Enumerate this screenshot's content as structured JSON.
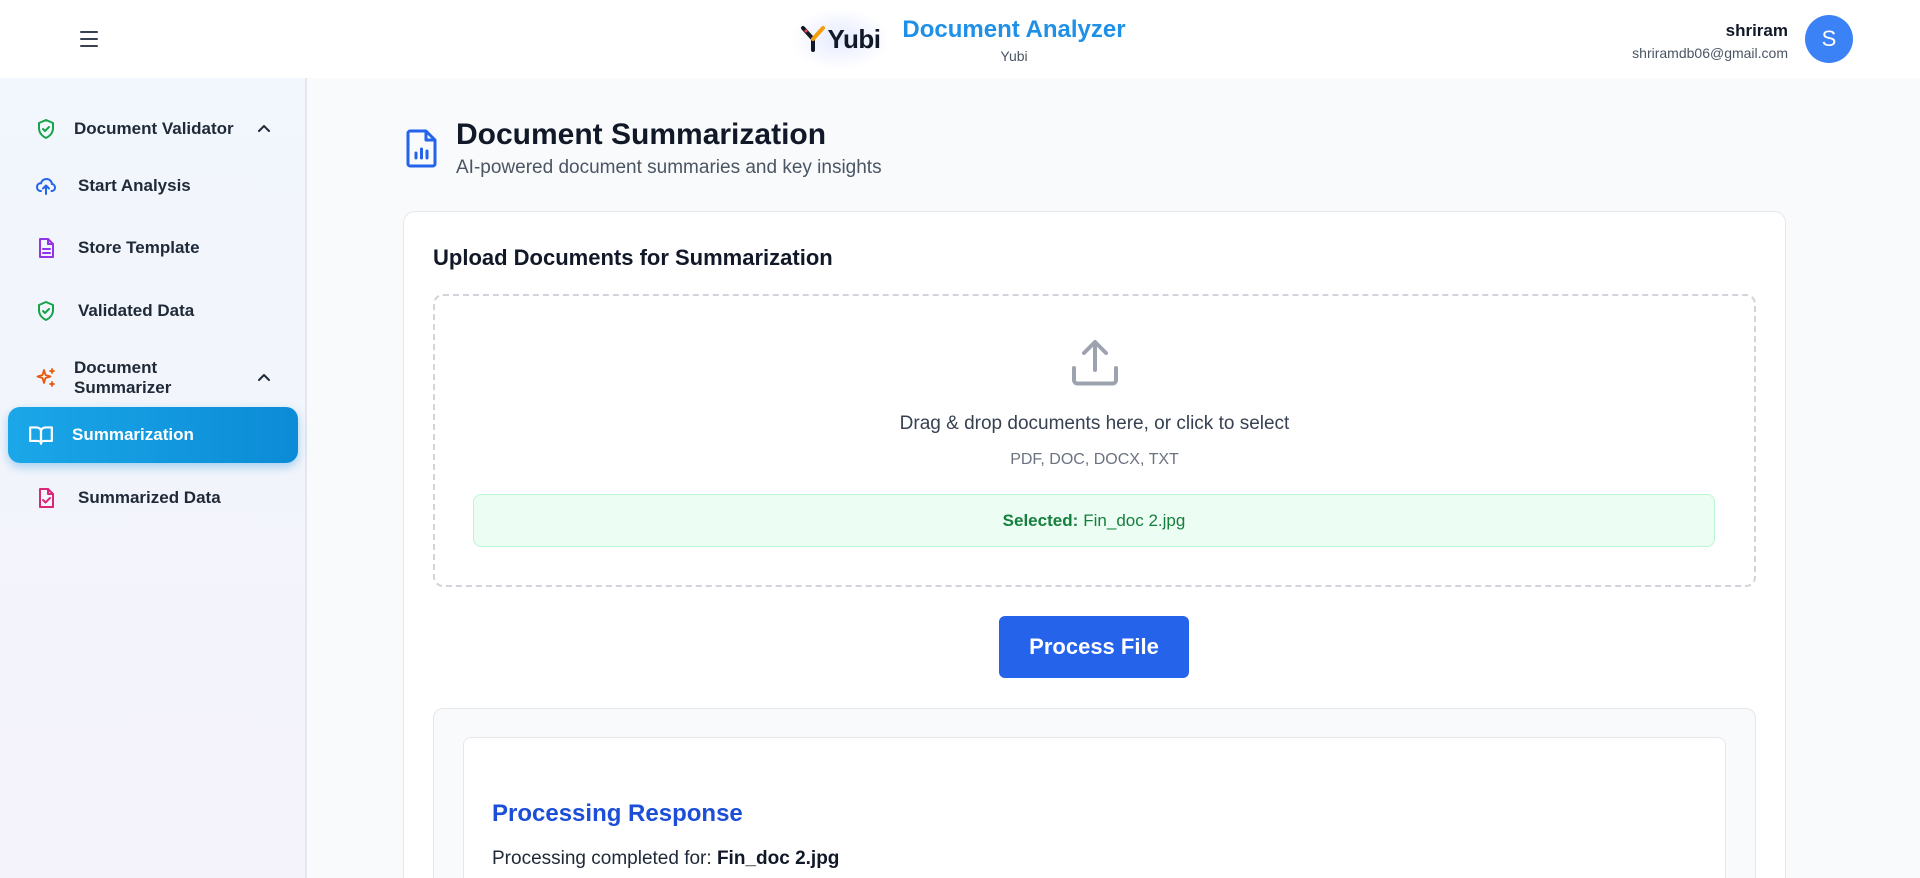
{
  "header": {
    "logo_text": "Yubi",
    "app_title": "Document Analyzer",
    "app_subtitle": "Yubi",
    "user_name": "shriram",
    "user_email": "shriramdb06@gmail.com",
    "avatar_initial": "S"
  },
  "sidebar": {
    "sections": [
      {
        "label": "Document Validator",
        "icon": "shield-check-icon",
        "items": [
          {
            "label": "Start Analysis",
            "icon": "cloud-upload-icon"
          },
          {
            "label": "Store Template",
            "icon": "file-text-icon"
          },
          {
            "label": "Validated Data",
            "icon": "shield-check-icon"
          }
        ]
      },
      {
        "label": "Document Summarizer",
        "icon": "sparkles-icon",
        "items": [
          {
            "label": "Summarization",
            "icon": "book-open-icon",
            "active": true
          },
          {
            "label": "Summarized Data",
            "icon": "file-check-icon"
          }
        ]
      }
    ]
  },
  "main": {
    "title": "Document Summarization",
    "subtitle": "AI-powered document summaries and key insights",
    "upload": {
      "title": "Upload Documents for Summarization",
      "drop_text": "Drag & drop documents here, or click to select",
      "file_types": "PDF, DOC, DOCX, TXT",
      "selected_label": "Selected:",
      "selected_file": "Fin_doc 2.jpg"
    },
    "process_button": "Process File",
    "response": {
      "title": "Processing Response",
      "line_prefix": "Processing completed for:",
      "file": "Fin_doc 2.jpg"
    }
  },
  "colors": {
    "accent": "#2563eb",
    "brand_title": "#1e90e8",
    "active_nav": "#0c8bd6",
    "success": "#15803d"
  }
}
